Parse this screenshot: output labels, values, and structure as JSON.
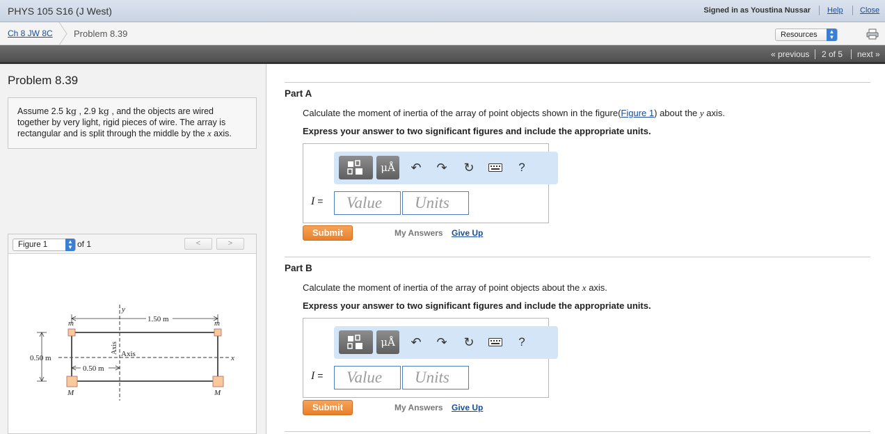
{
  "topbar": {
    "course_title": "PHYS 105 S16 (J West)",
    "signed_in": "Signed in as Youstina Nussar",
    "help": "Help",
    "close": "Close"
  },
  "breadcrumb": {
    "assignment": "Ch 8 JW 8C",
    "current": "Problem 8.39",
    "resources": "Resources"
  },
  "navigation": {
    "previous": "« previous",
    "position": "2 of 5",
    "next": "next »"
  },
  "problem": {
    "title": "Problem 8.39",
    "statement": {
      "t1": "Assume 2.5 ",
      "u1": "kg",
      "t2": " , 2.9 ",
      "u2": "kg",
      "t3": " , and the objects are wired together by very light, rigid pieces of wire. The array is rectangular and is split through the middle by the ",
      "axis": "x",
      "t4": " axis."
    }
  },
  "figure": {
    "selected": "Figure 1",
    "of_text": "of 1",
    "prev": "<",
    "next": ">",
    "labels": {
      "y": "y",
      "x": "x",
      "width": "1.50 m",
      "height": "0.50 m",
      "half": "0.50 m",
      "axis_vertical": "Axis",
      "axis_horizontal": "Axis",
      "m_top_left": "m",
      "m_top_right": "m",
      "M_bottom_left": "M",
      "M_bottom_right": "M"
    }
  },
  "parts": [
    {
      "title": "Part A",
      "question_pre": "Calculate the moment of inertia of the array of point objects shown in the figure(",
      "question_link": "Figure 1",
      "question_post": ") about the ",
      "axis": "y",
      "question_end": " axis.",
      "instruction": "Express your answer to two significant figures and include the appropriate units.",
      "variable": "I",
      "equals": "=",
      "value_placeholder": "Value",
      "units_placeholder": "Units",
      "submit": "Submit",
      "my_answers": "My Answers",
      "give_up": "Give Up"
    },
    {
      "title": "Part B",
      "question_pre": "Calculate the moment of inertia of the array of point objects about the ",
      "axis": "x",
      "question_end": " axis.",
      "instruction": "Express your answer to two significant figures and include the appropriate units.",
      "variable": "I",
      "equals": "=",
      "value_placeholder": "Value",
      "units_placeholder": "Units",
      "submit": "Submit",
      "my_answers": "My Answers",
      "give_up": "Give Up"
    }
  ],
  "toolbar": {
    "templates_icon": "templates-icon",
    "units_label": "μÅ",
    "undo_icon": "undo-icon",
    "redo_icon": "redo-icon",
    "reset_icon": "reset-icon",
    "keyboard_icon": "keyboard-icon",
    "help_label": "?"
  },
  "colors": {
    "link": "#1a4d9a",
    "submit": "#e9802a",
    "toolbar_bg": "#d4e5f8",
    "input_border": "#4b7fc6"
  }
}
